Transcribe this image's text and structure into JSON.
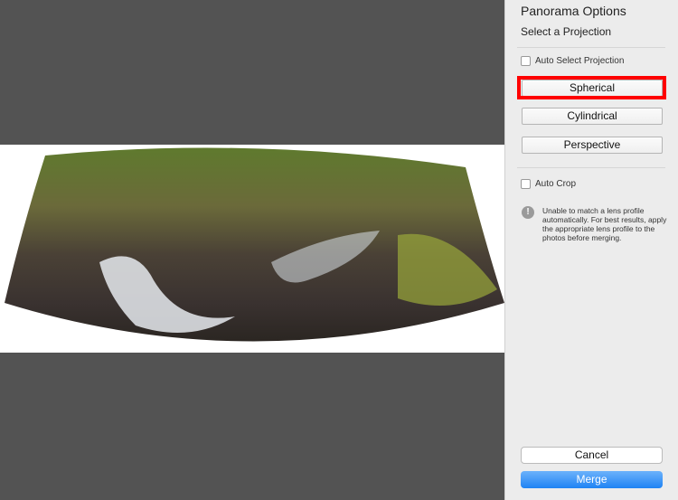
{
  "panel": {
    "title": "Panorama Options",
    "subtitle": "Select a Projection",
    "auto_select_label": "Auto Select Projection",
    "projections": [
      "Spherical",
      "Cylindrical",
      "Perspective"
    ],
    "auto_crop_label": "Auto Crop",
    "warning": "Unable to match a lens profile automatically. For best results, apply the appropriate lens profile to the photos before merging.",
    "warning_icon": "!",
    "cancel": "Cancel",
    "merge": "Merge"
  },
  "colors": {
    "highlight": "#ff0000",
    "merge": "#2a8af5"
  }
}
